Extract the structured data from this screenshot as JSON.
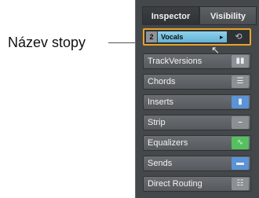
{
  "callout": {
    "label": "Název stopy"
  },
  "tabs": [
    {
      "label": "Inspector"
    },
    {
      "label": "Visibility"
    }
  ],
  "track": {
    "number": "2",
    "name": "Vocals",
    "arrow": "▸",
    "edit_icon": "edit-icon"
  },
  "sections": [
    {
      "label": "TrackVersions",
      "indicator": "gray",
      "icon": "versions-icon"
    },
    {
      "label": "Chords",
      "indicator": "gray",
      "icon": "chords-icon"
    },
    {
      "label": "Inserts",
      "indicator": "blue",
      "icon": "inserts-icon"
    },
    {
      "label": "Strip",
      "indicator": "gray",
      "icon": "strip-icon"
    },
    {
      "label": "Equalizers",
      "indicator": "green",
      "icon": "eq-icon"
    },
    {
      "label": "Sends",
      "indicator": "blue",
      "icon": "sends-icon"
    },
    {
      "label": "Direct Routing",
      "indicator": "gray",
      "icon": "routing-icon"
    }
  ],
  "colors": {
    "highlight": "#e8a22a",
    "track_name_bg": "#62b2d6",
    "indicator_blue": "#5a93d6",
    "indicator_green": "#55c05e",
    "indicator_gray": "#8c9095"
  }
}
